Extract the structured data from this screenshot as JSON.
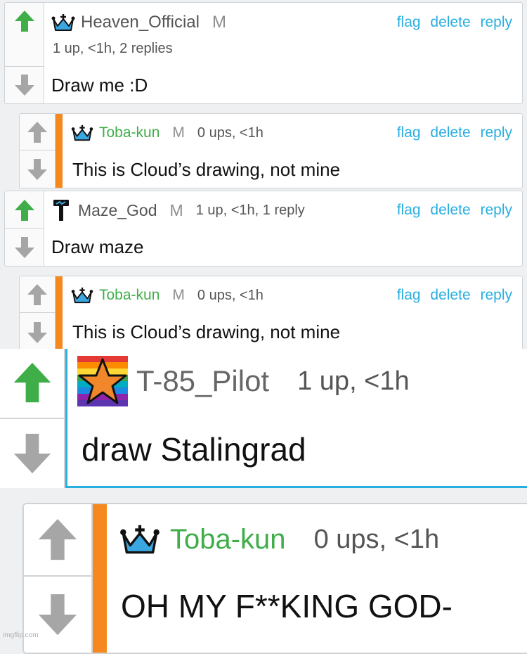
{
  "comments": [
    {
      "user": "Heaven_Official",
      "badge": "M",
      "meta": "1 up, <1h, 2 replies",
      "text": "Draw me :D",
      "actions": {
        "flag": "flag",
        "delete": "delete",
        "reply": "reply"
      }
    },
    {
      "user": "Toba-kun",
      "badge": "M",
      "meta": "0 ups, <1h",
      "text": "This is Cloud’s drawing, not mine",
      "actions": {
        "flag": "flag",
        "delete": "delete",
        "reply": "reply"
      }
    },
    {
      "user": "Maze_God",
      "badge": "M",
      "meta": "1 up, <1h, 1 reply",
      "text": "Draw maze",
      "actions": {
        "flag": "flag",
        "delete": "delete",
        "reply": "reply"
      }
    },
    {
      "user": "Toba-kun",
      "badge": "M",
      "meta": "0 ups, <1h",
      "text": "This is Cloud’s drawing, not mine",
      "actions": {
        "flag": "flag",
        "delete": "delete",
        "reply": "reply"
      }
    },
    {
      "user": "T-85_Pilot",
      "meta": "1 up, <1h",
      "text": "draw Stalingrad"
    },
    {
      "user": "Toba-kun",
      "meta": "0 ups, <1h",
      "text": "OH MY F**KING GOD-"
    }
  ],
  "watermark": "imgflip.com",
  "colors": {
    "upvote_active": "#3fae49",
    "vote_inactive": "#a6a6a6",
    "accent": "#f5891f",
    "link": "#29aee0",
    "name_green": "#3fae49"
  }
}
